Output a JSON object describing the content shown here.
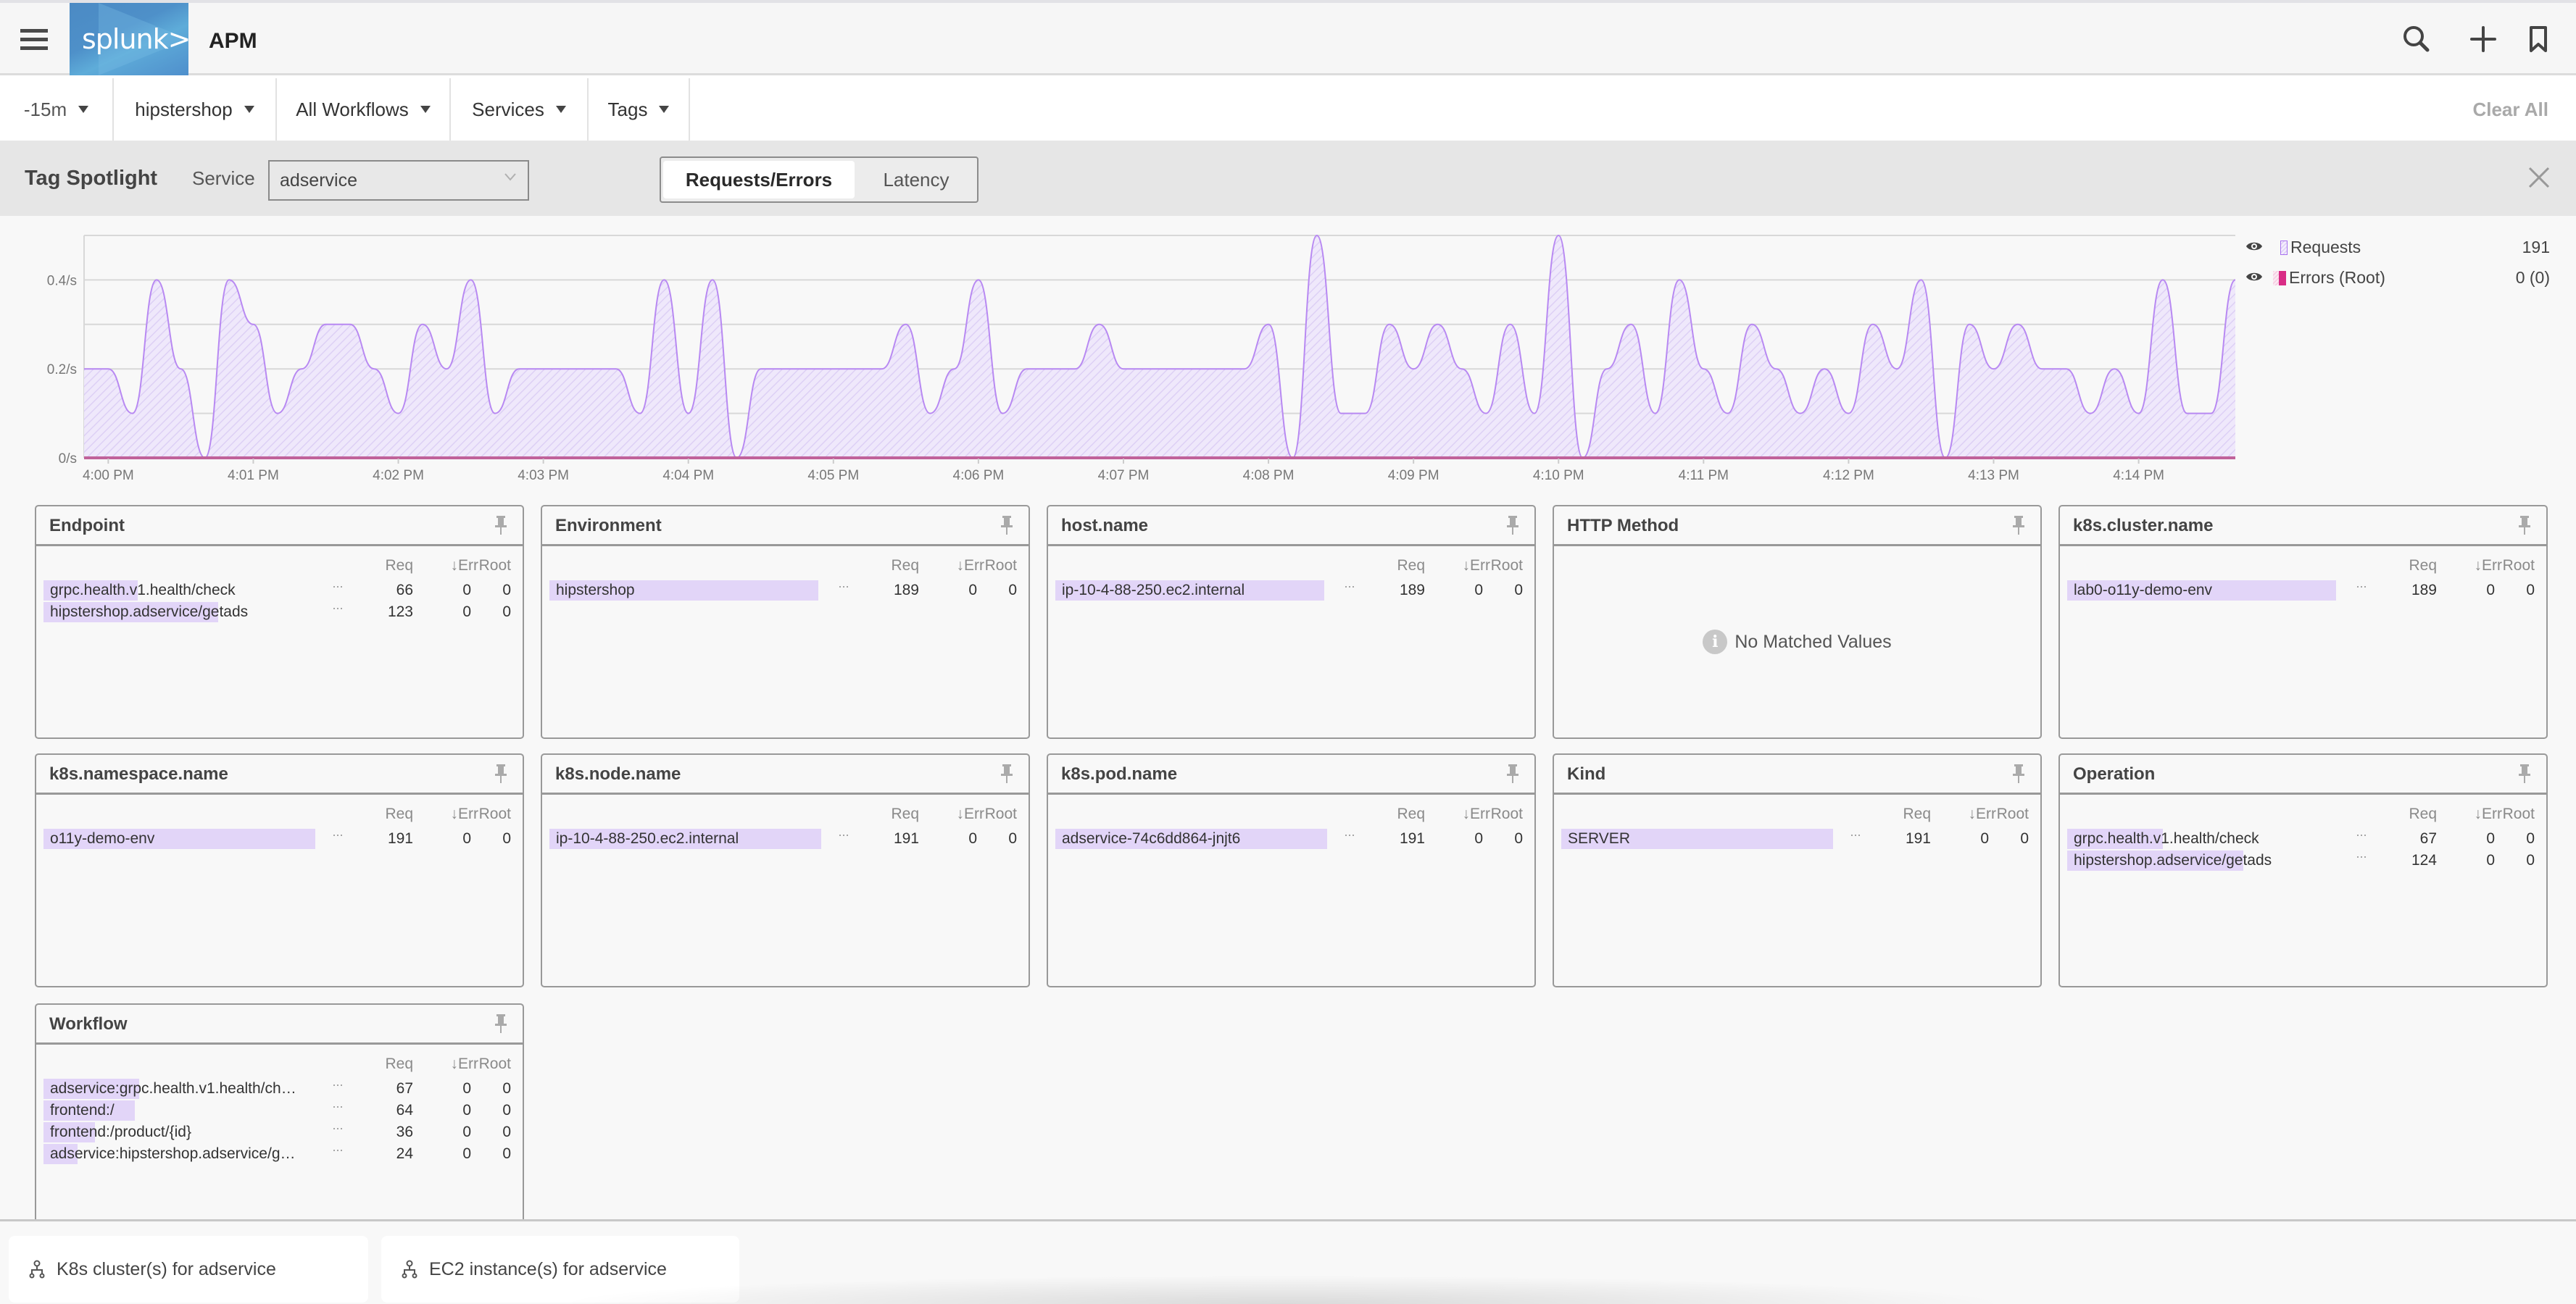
{
  "header": {
    "logo_text": "splunk>",
    "app_title": "APM",
    "icons": [
      "menu-icon",
      "search-icon",
      "plus-icon",
      "bookmark-icon"
    ]
  },
  "filters": {
    "items": [
      {
        "label": "-15m"
      },
      {
        "label": "hipstershop"
      },
      {
        "label": "All Workflows"
      },
      {
        "label": "Services"
      },
      {
        "label": "Tags"
      }
    ],
    "clear_all": "Clear All"
  },
  "spotlight": {
    "title": "Tag Spotlight",
    "service_label": "Service",
    "service_value": "adservice",
    "tabs": [
      {
        "label": "Requests/Errors",
        "active": true
      },
      {
        "label": "Latency",
        "active": false
      }
    ]
  },
  "legend": [
    {
      "label": "Requests",
      "value": "191",
      "color": "#b07ef0"
    },
    {
      "label": "Errors (Root)",
      "value": "0 (0)",
      "color": "#d6307f"
    }
  ],
  "chart_data": {
    "type": "area",
    "title": "",
    "xlabel": "",
    "ylabel": "",
    "ylim": [
      0,
      0.5
    ],
    "y_ticks": [
      {
        "value": 0,
        "label": "0/s"
      },
      {
        "value": 0.2,
        "label": "0.2/s"
      },
      {
        "value": 0.4,
        "label": "0.4/s"
      }
    ],
    "gridlines": [
      0,
      0.1,
      0.2,
      0.3,
      0.4,
      0.5
    ],
    "x_start": "3:59:50 PM",
    "x_interval_seconds": 10,
    "x_ticks": [
      "4:00 PM",
      "4:01 PM",
      "4:02 PM",
      "4:03 PM",
      "4:04 PM",
      "4:05 PM",
      "4:06 PM",
      "4:07 PM",
      "4:08 PM",
      "4:09 PM",
      "4:10 PM",
      "4:11 PM",
      "4:12 PM",
      "4:13 PM",
      "4:14 PM"
    ],
    "x_tick_offsets": [
      1,
      7,
      13,
      19,
      25,
      31,
      37,
      43,
      49,
      55,
      61,
      67,
      73,
      79,
      85
    ],
    "series": [
      {
        "name": "Requests",
        "unit": "/s",
        "color": "#b889f2",
        "values": [
          0.2,
          0.2,
          0.1,
          0.4,
          0.2,
          0,
          0.4,
          0.3,
          0.1,
          0.2,
          0.3,
          0.3,
          0.2,
          0.1,
          0.3,
          0.2,
          0.4,
          0.1,
          0.2,
          0.2,
          0.2,
          0.2,
          0.2,
          0.1,
          0.4,
          0.1,
          0.4,
          0,
          0.2,
          0.2,
          0.2,
          0.2,
          0.2,
          0.2,
          0.3,
          0.1,
          0.2,
          0.4,
          0.1,
          0.2,
          0.2,
          0.2,
          0.3,
          0.2,
          0.2,
          0.2,
          0.2,
          0.2,
          0.2,
          0.3,
          0,
          0.5,
          0.1,
          0.1,
          0.3,
          0.2,
          0.3,
          0.2,
          0.1,
          0.3,
          0.1,
          0.5,
          0,
          0.2,
          0.3,
          0.1,
          0.4,
          0.2,
          0.1,
          0.3,
          0.2,
          0.1,
          0.2,
          0.1,
          0.3,
          0.2,
          0.4,
          0,
          0.3,
          0.2,
          0.3,
          0.2,
          0.2,
          0.1,
          0.2,
          0.1,
          0.4,
          0.1,
          0.1,
          0.4
        ]
      },
      {
        "name": "Errors (Root)",
        "unit": "/s",
        "color": "#c0629a",
        "values": [
          0,
          0,
          0,
          0,
          0,
          0,
          0,
          0,
          0,
          0,
          0,
          0,
          0,
          0,
          0,
          0,
          0,
          0,
          0,
          0,
          0,
          0,
          0,
          0,
          0,
          0,
          0,
          0,
          0,
          0,
          0,
          0,
          0,
          0,
          0,
          0,
          0,
          0,
          0,
          0,
          0,
          0,
          0,
          0,
          0,
          0,
          0,
          0,
          0,
          0,
          0,
          0,
          0,
          0,
          0,
          0,
          0,
          0,
          0,
          0,
          0,
          0,
          0,
          0,
          0,
          0,
          0,
          0,
          0,
          0,
          0,
          0,
          0,
          0,
          0,
          0,
          0,
          0,
          0,
          0,
          0,
          0,
          0,
          0,
          0,
          0,
          0,
          0,
          0,
          0
        ]
      }
    ],
    "legend_position": "right"
  },
  "cards": {
    "columns": {
      "req": "Req",
      "err": "↓Err",
      "root": "Root"
    },
    "more": "···",
    "no_match": "No Matched Values",
    "items": [
      {
        "title": "Endpoint",
        "rows": [
          {
            "label": "grpc.health.v1.health/check",
            "req": 66,
            "err": 0,
            "root": 0
          },
          {
            "label": "hipstershop.adservice/getads",
            "req": 123,
            "err": 0,
            "root": 0
          }
        ]
      },
      {
        "title": "Environment",
        "rows": [
          {
            "label": "hipstershop",
            "req": 189,
            "err": 0,
            "root": 0
          }
        ]
      },
      {
        "title": "host.name",
        "rows": [
          {
            "label": "ip-10-4-88-250.ec2.internal",
            "req": 189,
            "err": 0,
            "root": 0
          }
        ]
      },
      {
        "title": "HTTP Method",
        "rows": []
      },
      {
        "title": "k8s.cluster.name",
        "rows": [
          {
            "label": "lab0-o11y-demo-env",
            "req": 189,
            "err": 0,
            "root": 0
          }
        ]
      },
      {
        "title": "k8s.namespace.name",
        "rows": [
          {
            "label": "o11y-demo-env",
            "req": 191,
            "err": 0,
            "root": 0
          }
        ]
      },
      {
        "title": "k8s.node.name",
        "rows": [
          {
            "label": "ip-10-4-88-250.ec2.internal",
            "req": 191,
            "err": 0,
            "root": 0
          }
        ]
      },
      {
        "title": "k8s.pod.name",
        "rows": [
          {
            "label": "adservice-74c6dd864-jnjt6",
            "req": 191,
            "err": 0,
            "root": 0
          }
        ]
      },
      {
        "title": "Kind",
        "rows": [
          {
            "label": "SERVER",
            "req": 191,
            "err": 0,
            "root": 0
          }
        ]
      },
      {
        "title": "Operation",
        "rows": [
          {
            "label": "grpc.health.v1.health/check",
            "req": 67,
            "err": 0,
            "root": 0
          },
          {
            "label": "hipstershop.adservice/getads",
            "req": 124,
            "err": 0,
            "root": 0
          }
        ]
      },
      {
        "title": "Workflow",
        "rows": [
          {
            "label": "adservice:grpc.health.v1.health/ch…",
            "req": 67,
            "err": 0,
            "root": 0
          },
          {
            "label": "frontend:/",
            "req": 64,
            "err": 0,
            "root": 0
          },
          {
            "label": "frontend:/product/{id}",
            "req": 36,
            "err": 0,
            "root": 0
          },
          {
            "label": "adservice:hipstershop.adservice/g…",
            "req": 24,
            "err": 0,
            "root": 0
          }
        ]
      }
    ]
  },
  "bottom": {
    "links": [
      {
        "label": "K8s cluster(s) for adservice",
        "icon": "hierarchy-icon"
      },
      {
        "label": "EC2 instance(s) for adservice",
        "icon": "hierarchy-icon"
      }
    ]
  }
}
